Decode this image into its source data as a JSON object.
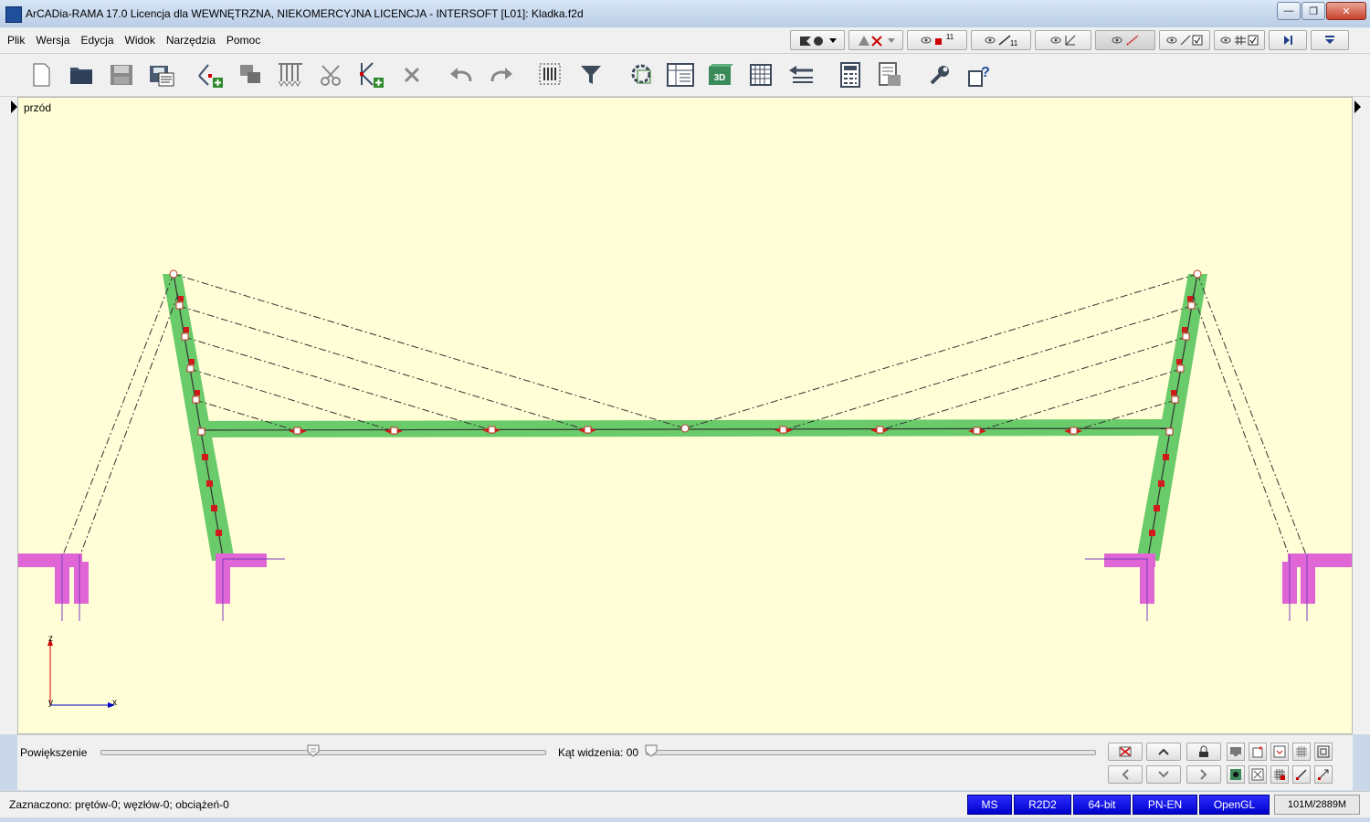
{
  "window": {
    "title": "ArCADia-RAMA 17.0 Licencja dla WEWNĘTRZNA, NIEKOMERCYJNA LICENCJA - INTERSOFT [L01]: Kladka.f2d",
    "controls": [
      "minimize",
      "maximize",
      "close"
    ]
  },
  "menu": {
    "items": [
      "Plik",
      "Wersja",
      "Edycja",
      "Widok",
      "Narzędzia",
      "Pomoc"
    ]
  },
  "view_toolbar": {
    "icons": [
      "display-mode-icon",
      "load-display-icon",
      "node-numbers-icon",
      "bar-numbers-icon",
      "supports-visibility-icon",
      "loads-visibility-icon",
      "bar-visibility-checkbox",
      "grid-visibility-checkbox",
      "collapse-icon",
      "dropdown-icon"
    ],
    "node_count_badge": "11",
    "bar_count_badge": "11"
  },
  "main_toolbar": {
    "icons": [
      "new-file-icon",
      "open-file-icon",
      "save-icon",
      "save-as-icon",
      "add-node-icon",
      "copy-icon",
      "add-load-icon",
      "cut-icon",
      "add-bar-icon",
      "delete-icon",
      "undo-icon",
      "redo-icon",
      "select-region-icon",
      "filter-icon",
      "properties-icon",
      "table-icon",
      "view-3d-icon",
      "grid-table-icon",
      "sort-icon",
      "calculator-icon",
      "report-icon",
      "settings-wrench-icon",
      "help-icon"
    ],
    "label_3d": "3D"
  },
  "canvas": {
    "view_name": "przód",
    "axis_z_label": "z",
    "axis_x_label": "x",
    "axis_y_label": "y",
    "background": "#fffed6",
    "colors": {
      "bar_fill": "#6acb6a",
      "support": "#e066d6",
      "node_red": "#d11b1b",
      "cable": "#333333"
    }
  },
  "bottom_panel": {
    "zoom_label": "Powiększenie",
    "zoom_level": 0.48,
    "angle_label": "Kąt widzenia: 00",
    "angle_level": 0.0
  },
  "status": {
    "selection": "Zaznaczono: prętów-0; węzłów-0; obciążeń-0",
    "badges": [
      "MS",
      "R2D2",
      "64-bit",
      "PN-EN",
      "OpenGL"
    ],
    "memory": "101M/2889M"
  }
}
